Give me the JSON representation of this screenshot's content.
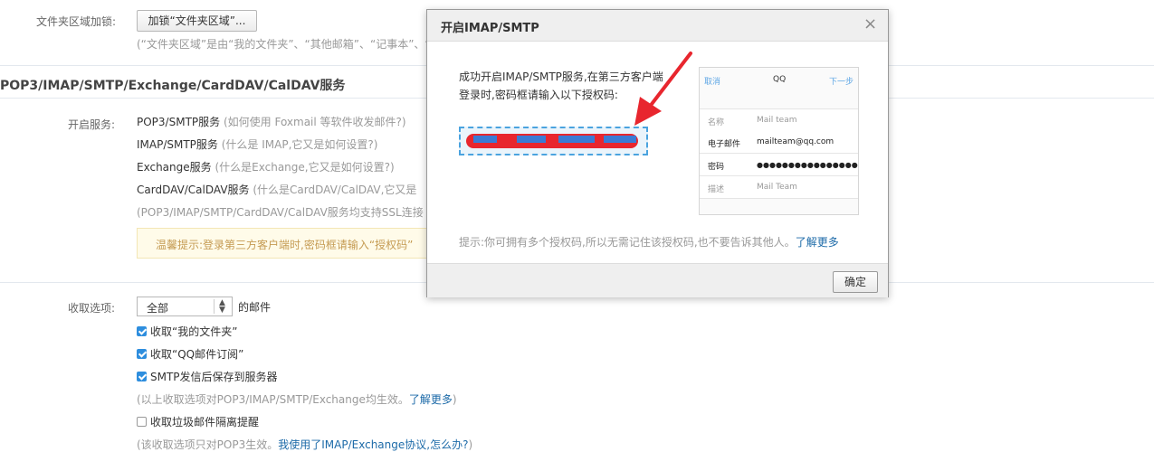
{
  "folder_lock": {
    "label": "文件夹区域加锁:",
    "button": "加锁“文件夹区域”...",
    "note": "(“文件夹区域”是由“我的文件夹”、“其他邮箱”、“记事本”、“"
  },
  "section": {
    "title": "POP3/IMAP/SMTP/Exchange/CardDAV/CalDAV服务"
  },
  "services": {
    "label": "开启服务:",
    "items": [
      {
        "name": "POP3/SMTP服务",
        "hint": "(如何使用 Foxmail 等软件收发邮件?)"
      },
      {
        "name": "IMAP/SMTP服务",
        "hint": "(什么是 IMAP,它又是如何设置?)"
      },
      {
        "name": "Exchange服务",
        "hint": "(什么是Exchange,它又是如何设置?)"
      },
      {
        "name": "CardDAV/CalDAV服务",
        "hint": "(什么是CardDAV/CalDAV,它又是"
      }
    ],
    "ssl_note": "(POP3/IMAP/SMTP/CardDAV/CalDAV服务均支持SSL连接",
    "tip": "温馨提示:登录第三方客户端时,密码框请输入“授权码”"
  },
  "receive": {
    "label": "收取选项:",
    "select_value": "全部",
    "select_suffix": "的邮件",
    "options": [
      {
        "label": "收取“我的文件夹”",
        "checked": true
      },
      {
        "label": "收取“QQ邮件订阅”",
        "checked": true
      },
      {
        "label": "SMTP发信后保存到服务器",
        "checked": true
      }
    ],
    "note_prefix": "(以上收取选项对POP3/IMAP/SMTP/Exchange均生效。",
    "note_link": "了解更多",
    "note_suffix": ")",
    "spam_option": {
      "label": "收取垃圾邮件隔离提醒",
      "checked": false
    },
    "spam_note_prefix": "(该收取选项只对POP3生效。",
    "spam_note_link": "我使用了IMAP/Exchange协议,怎么办?",
    "spam_note_suffix": ")"
  },
  "modal": {
    "title": "开启IMAP/SMTP",
    "close": "×",
    "message_line1": "成功开启IMAP/SMTP服务,在第三方客户端",
    "message_line2": "登录时,密码框请输入以下授权码:",
    "phone": {
      "cancel": "取消",
      "title": "QQ",
      "next": "下一步",
      "rows": [
        {
          "key": "名称",
          "value": "Mail team"
        },
        {
          "key": "电子邮件",
          "value": "mailteam@qq.com"
        },
        {
          "key": "密码",
          "value": "●●●●●●●●●●●●●●●●"
        },
        {
          "key": "描述",
          "value": "Mail Team"
        }
      ]
    },
    "hint": "提示:你可拥有多个授权码,所以无需记住该授权码,也不要告诉其他人。",
    "hint_link": "了解更多",
    "ok": "确定"
  },
  "colors": {
    "link": "#1c6aa8",
    "arrow": "#e8262e",
    "checkbox": "#2e8ede"
  }
}
